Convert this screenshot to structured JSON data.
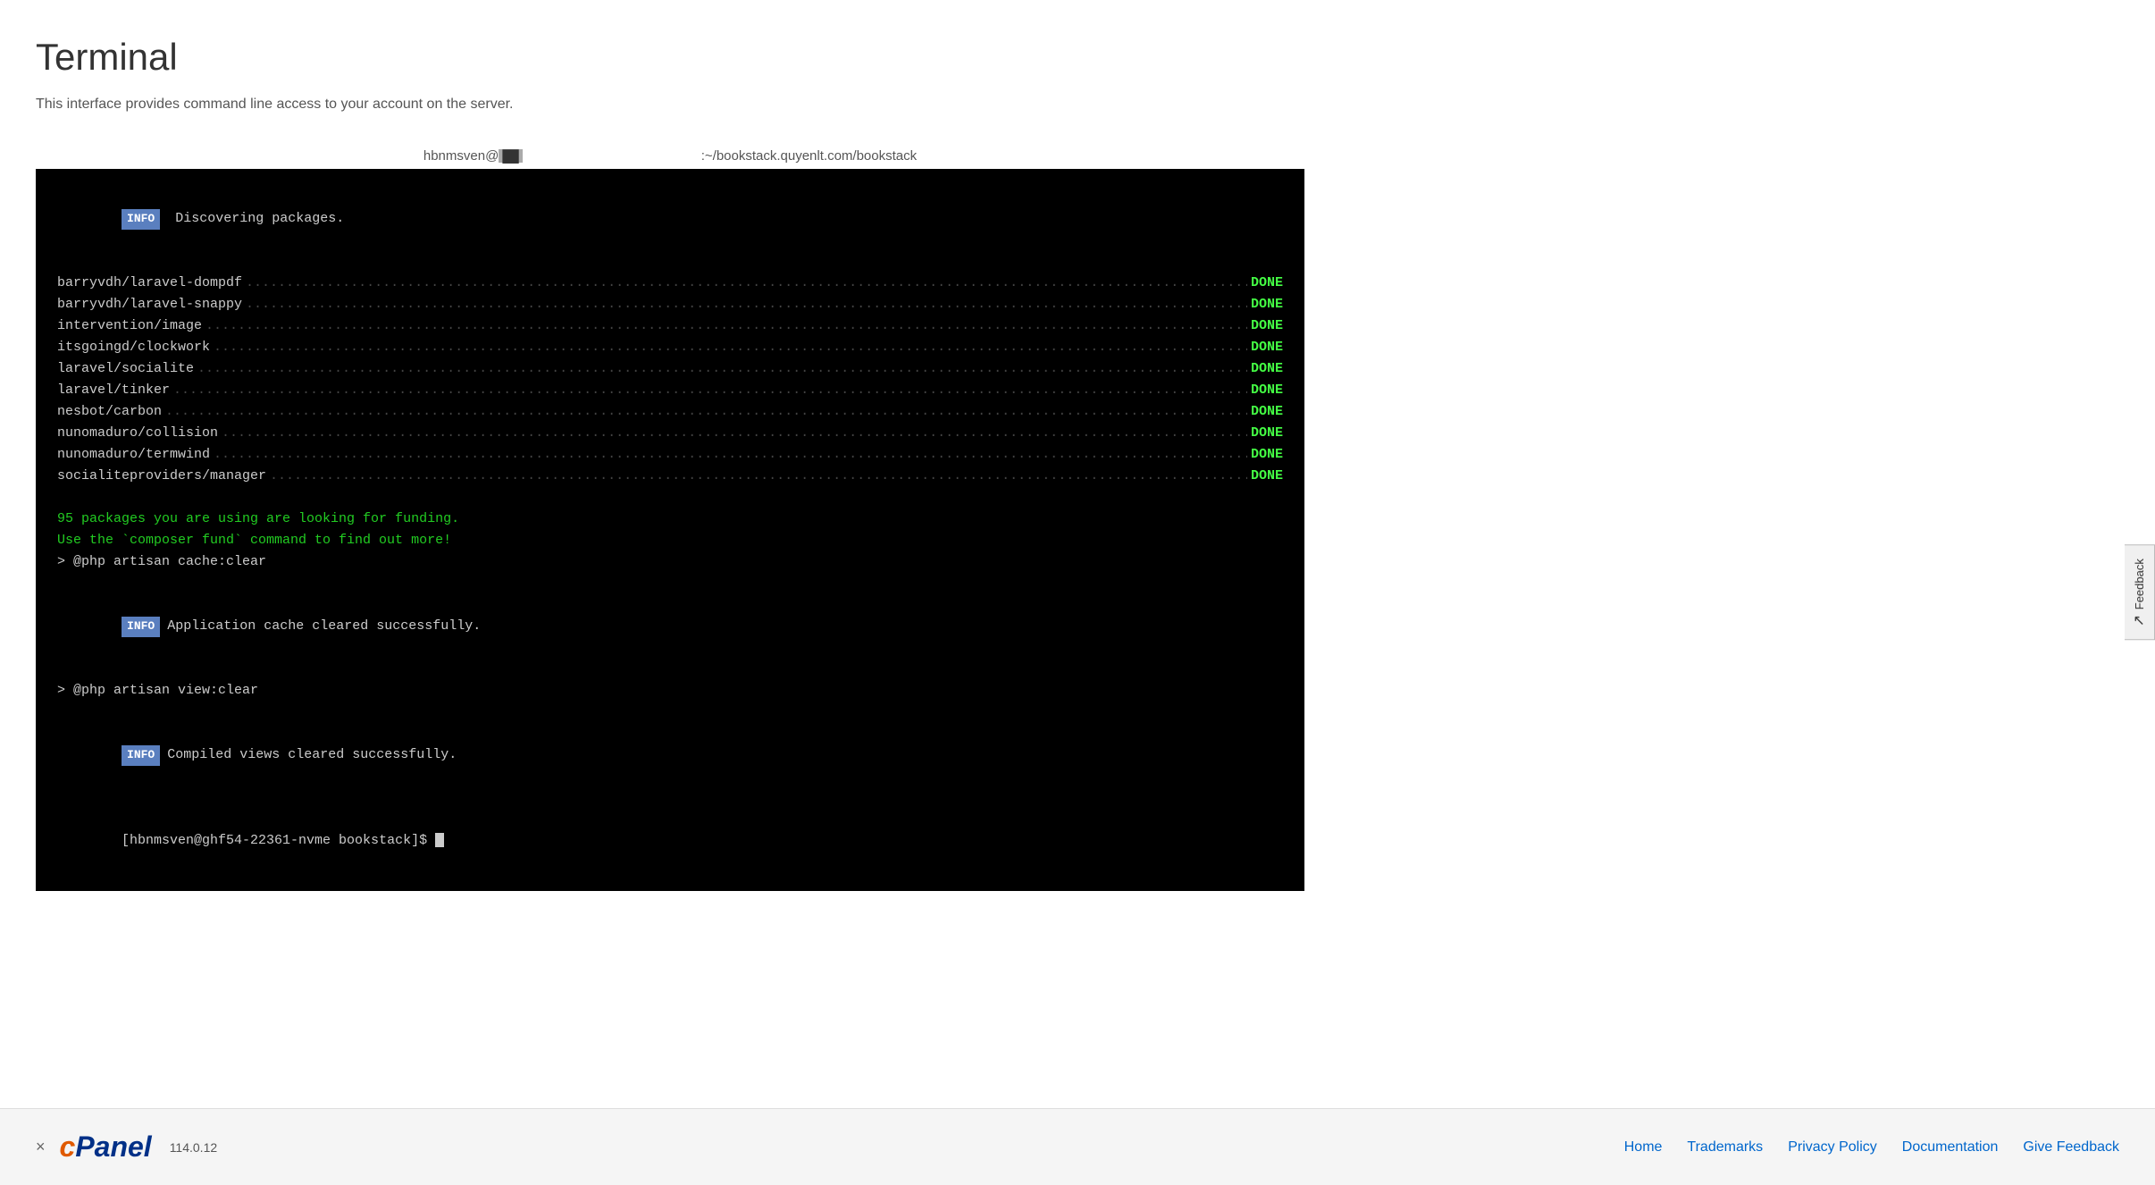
{
  "page": {
    "title": "Terminal",
    "description": "This interface provides command line access to your account on the server."
  },
  "terminal": {
    "header_user": "hbnmsven@",
    "header_path": ":~/bookstack.quyenlt.com/bookstack",
    "packages": [
      {
        "name": "barryvdh/laravel-dompdf",
        "status": "DONE"
      },
      {
        "name": "barryvdh/laravel-snappy",
        "status": "DONE"
      },
      {
        "name": "intervention/image",
        "status": "DONE"
      },
      {
        "name": "itsgoingd/clockwork",
        "status": "DONE"
      },
      {
        "name": "laravel/socialite",
        "status": "DONE"
      },
      {
        "name": "laravel/tinker",
        "status": "DONE"
      },
      {
        "name": "nesbot/carbon",
        "status": "DONE"
      },
      {
        "name": "nunomaduro/collision",
        "status": "DONE"
      },
      {
        "name": "nunomaduro/termwind",
        "status": "DONE"
      },
      {
        "name": "socialiteproviders/manager",
        "status": "DONE"
      }
    ],
    "funding_line1": "95 packages you are using are looking for funding.",
    "funding_line2": "Use the `composer fund` command to find out more!",
    "cmd1": "> @php artisan cache:clear",
    "info1": "Application cache cleared successfully.",
    "cmd2": "> @php artisan view:clear",
    "info2": "Compiled views cleared successfully.",
    "prompt": "[hbnmsven@ghf54-22361-nvme bookstack]$ ",
    "info_label": "INFO"
  },
  "footer": {
    "close_label": "×",
    "cpanel_c": "c",
    "cpanel_text": "Panel",
    "version": "114.0.12",
    "links": [
      {
        "label": "Home",
        "id": "home"
      },
      {
        "label": "Trademarks",
        "id": "trademarks"
      },
      {
        "label": "Privacy Policy",
        "id": "privacy-policy"
      },
      {
        "label": "Documentation",
        "id": "documentation"
      },
      {
        "label": "Give Feedback",
        "id": "give-feedback"
      }
    ]
  },
  "sidebar": {
    "feedback_icon": "↗",
    "feedback_label": "Feedback"
  }
}
